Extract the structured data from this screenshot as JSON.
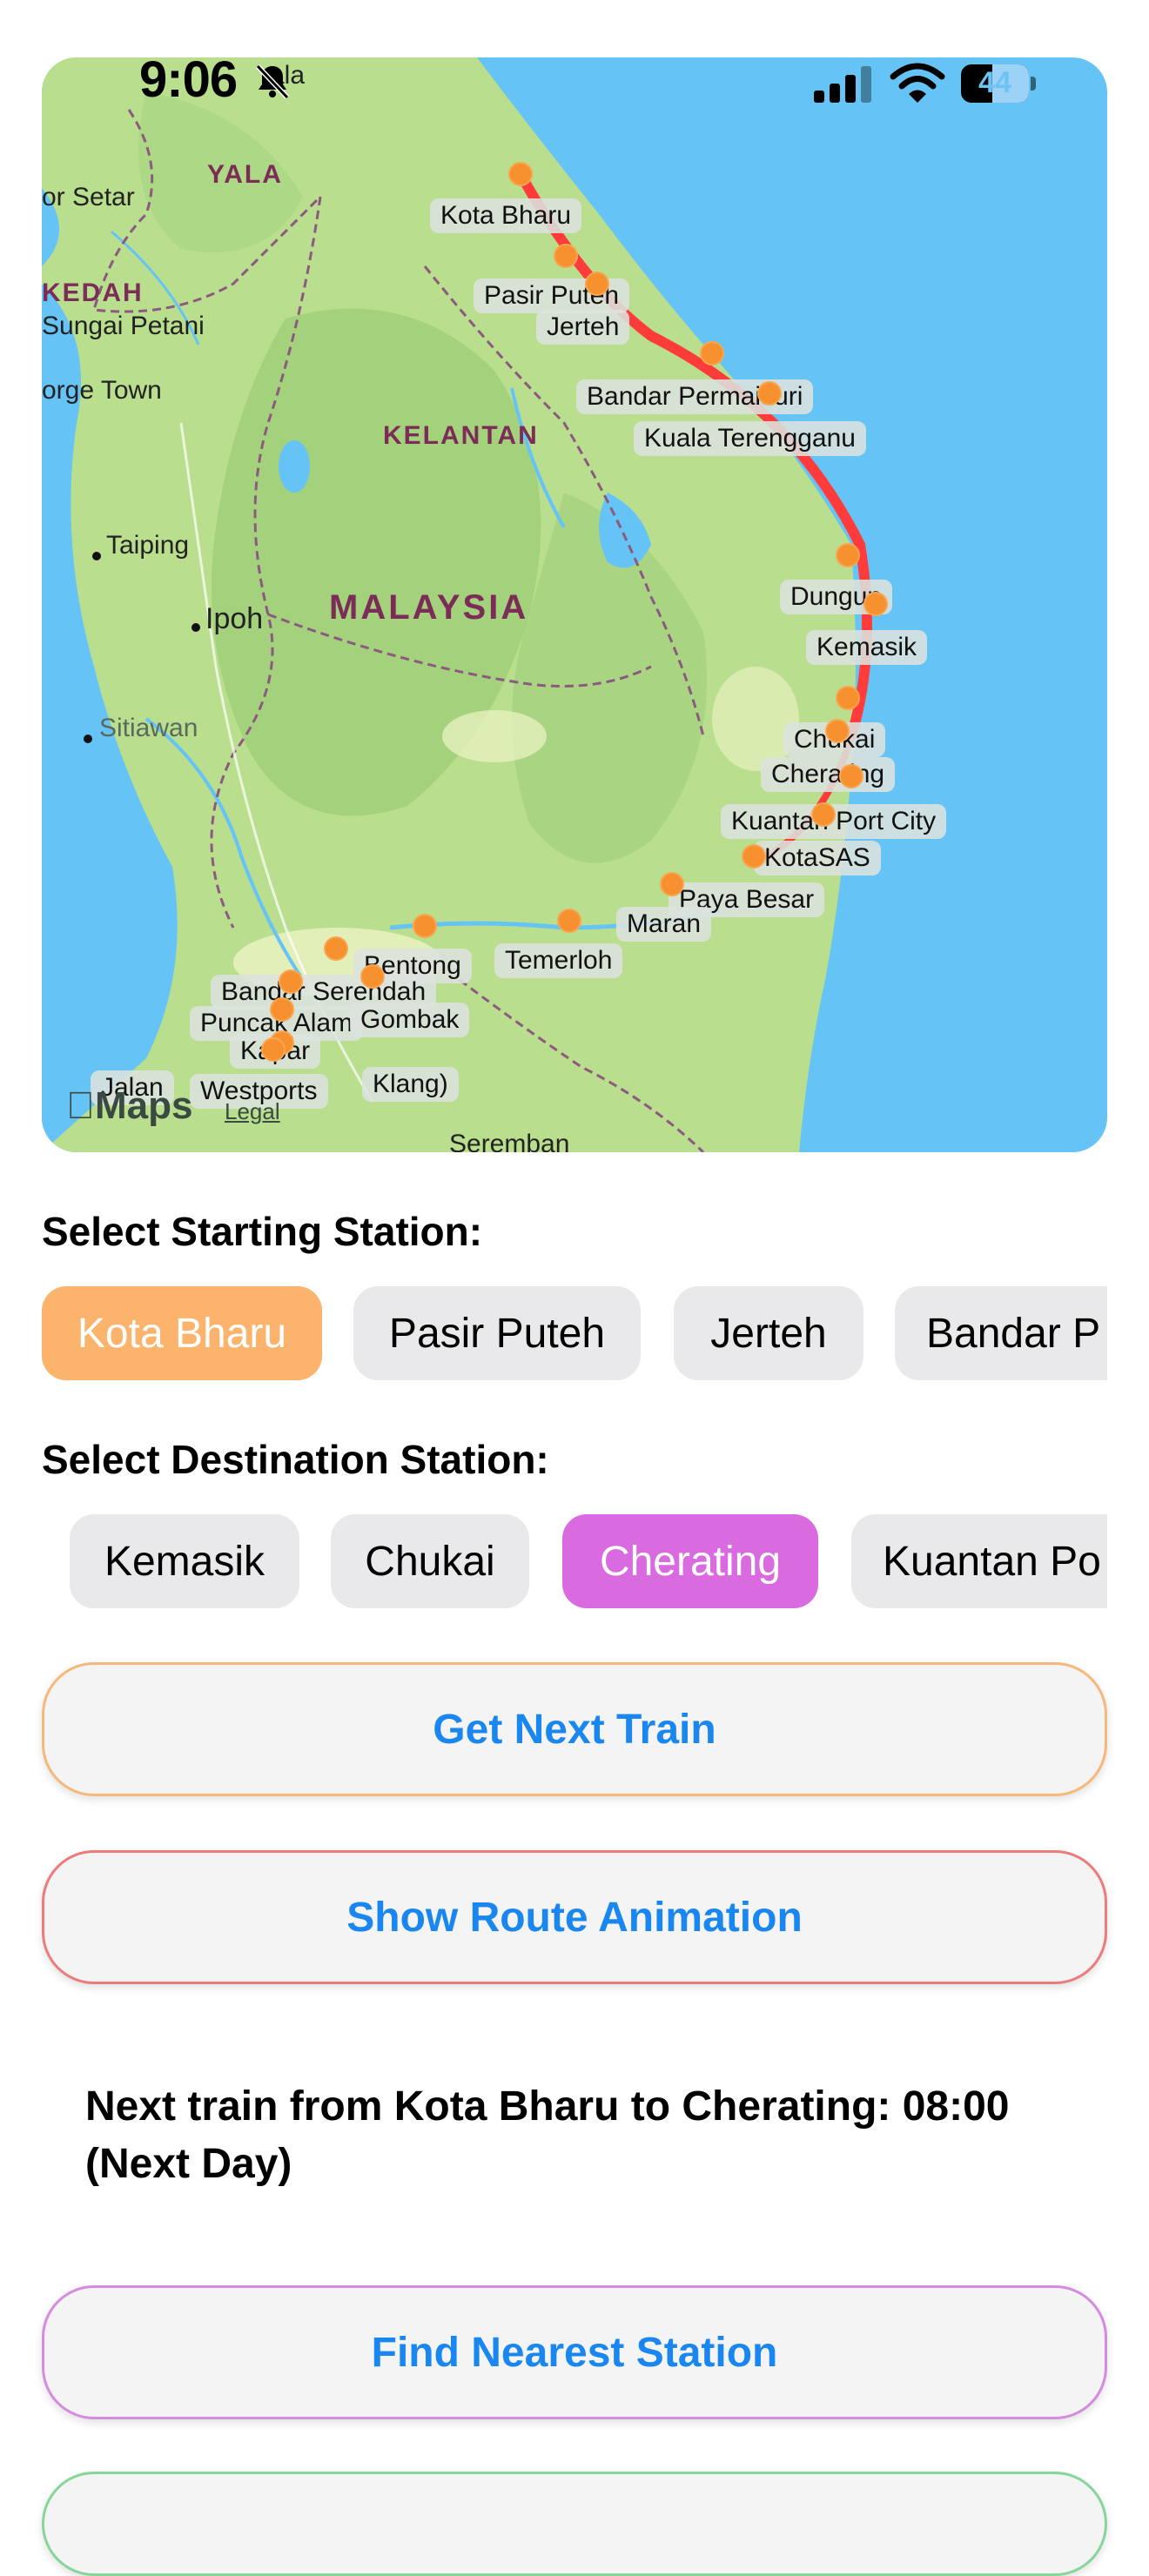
{
  "status_bar": {
    "time": "9:06",
    "battery": "44",
    "icons": [
      "bell-slash-icon",
      "cellular-signal-icon",
      "wifi-icon",
      "battery-icon"
    ]
  },
  "map": {
    "attribution": "Maps",
    "legal": "Legal",
    "place_labels": [
      "ala",
      "YALA",
      "or Setar",
      "KEDAH",
      "Sungai Petani",
      "orge Town",
      "KELANTAN",
      "Taiping",
      "Ipoh",
      "MALAYSIA",
      "Sitiawan",
      "Seremban",
      "Jalan",
      "Klang)"
    ],
    "station_labels": [
      "Kota Bharu",
      "Pasir Puteh",
      "Jerteh",
      "Bandar Permaisuri",
      "Kuala Terengganu",
      "Dungun",
      "Kemasik",
      "Chukai",
      "Cherating",
      "Kuantan Port City",
      "KotaSAS",
      "Paya Besar",
      "Maran",
      "Temerloh",
      "Bentong",
      "Bandar Serendah",
      "Puncak Alam",
      "Gombak",
      "Kapar",
      "Westports"
    ],
    "colors": {
      "water": "#66c3f5",
      "land": "#b9de8d",
      "route": "#ff3b3b",
      "station": "#f7902f"
    }
  },
  "start": {
    "heading": "Select Starting Station:",
    "chips": [
      "Kota Bharu",
      "Pasir Puteh",
      "Jerteh",
      "Bandar P"
    ],
    "selected": "Kota Bharu"
  },
  "destination": {
    "heading": "Select Destination Station:",
    "chips": [
      "Kemasik",
      "Chukai",
      "Cherating",
      "Kuantan Po"
    ],
    "selected": "Cherating"
  },
  "buttons": {
    "next_train": "Get Next Train",
    "route_animation": "Show Route Animation",
    "nearest_station": "Find Nearest Station"
  },
  "result": {
    "text": "Next train from Kota Bharu to Cherating: 08:00 (Next Day)"
  }
}
